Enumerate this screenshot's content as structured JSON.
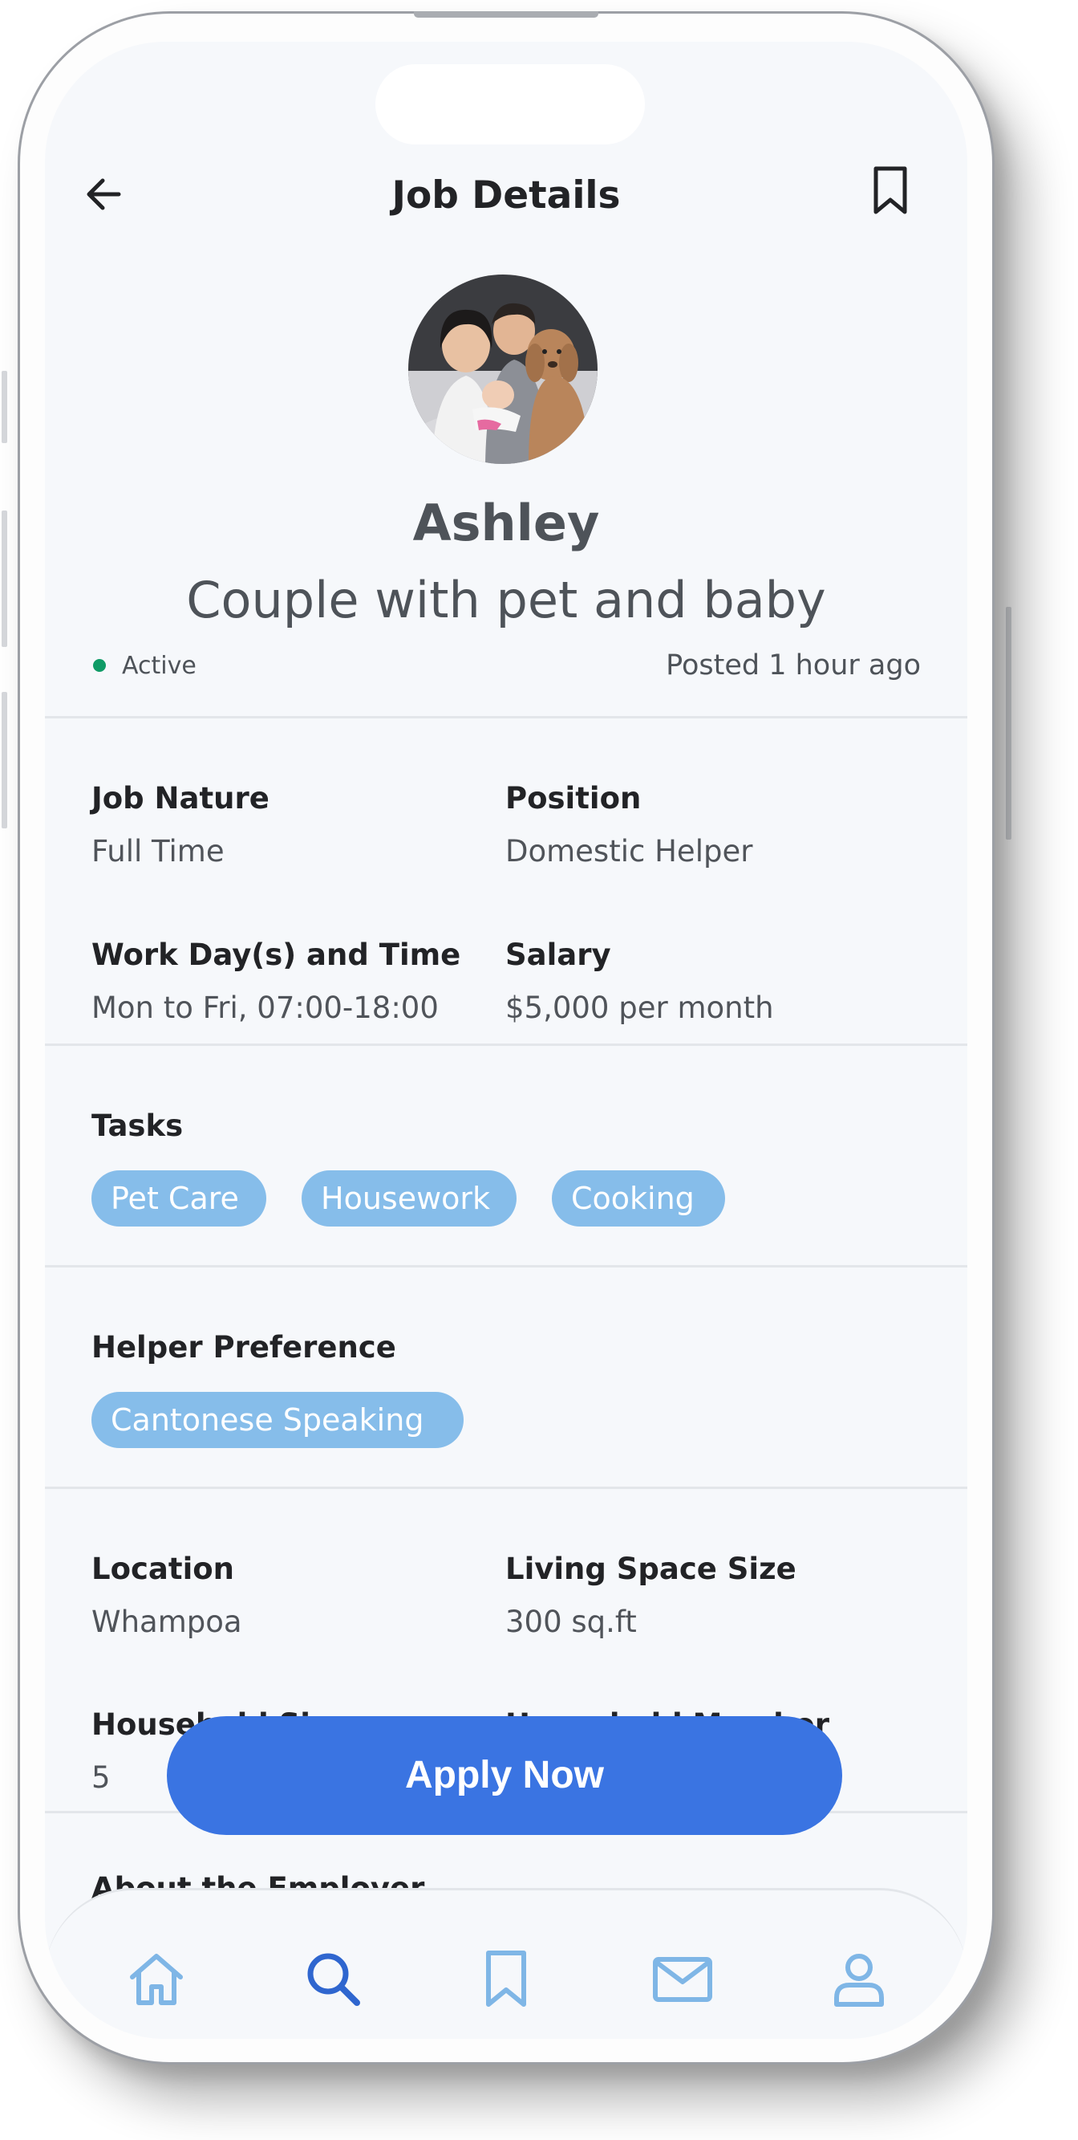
{
  "header": {
    "title": "Job Details",
    "icons": {
      "back": "arrow-left-icon",
      "save": "bookmark-icon"
    }
  },
  "profile": {
    "name": "Ashley",
    "headline": "Couple with pet and baby",
    "status": "Active",
    "posted": "Posted 1 hour ago",
    "status_color": "#0f9b66"
  },
  "job": {
    "nature_label": "Job Nature",
    "nature_value": "Full Time",
    "position_label": "Position",
    "position_value": "Domestic Helper",
    "workday_label": "Work Day(s) and Time",
    "workday_value": "Mon to Fri, 07:00-18:00",
    "salary_label": "Salary",
    "salary_value": "$5,000 per month"
  },
  "tasks": {
    "title": "Tasks",
    "items": [
      "Pet Care",
      "Housework",
      "Cooking"
    ]
  },
  "preference": {
    "title": "Helper Preference",
    "items": [
      "Cantonese Speaking"
    ]
  },
  "household": {
    "location_label": "Location",
    "location_value": "Whampoa",
    "space_label": "Living Space Size",
    "space_value": "300 sq.ft",
    "size_label": "Household Size",
    "size_value": "5",
    "member_label": "Household Member"
  },
  "about": {
    "title": "About the Employer"
  },
  "apply_label": "Apply Now",
  "tabbar": {
    "items": [
      {
        "name": "home-icon",
        "active": false
      },
      {
        "name": "search-icon",
        "active": true
      },
      {
        "name": "bookmark-icon",
        "active": false
      },
      {
        "name": "mail-icon",
        "active": false
      },
      {
        "name": "profile-icon",
        "active": false
      }
    ]
  },
  "colors": {
    "accent": "#3a74e2",
    "chip": "#86bdea",
    "tab_inactive": "#7fb6e6",
    "tab_active": "#2f66cf"
  }
}
